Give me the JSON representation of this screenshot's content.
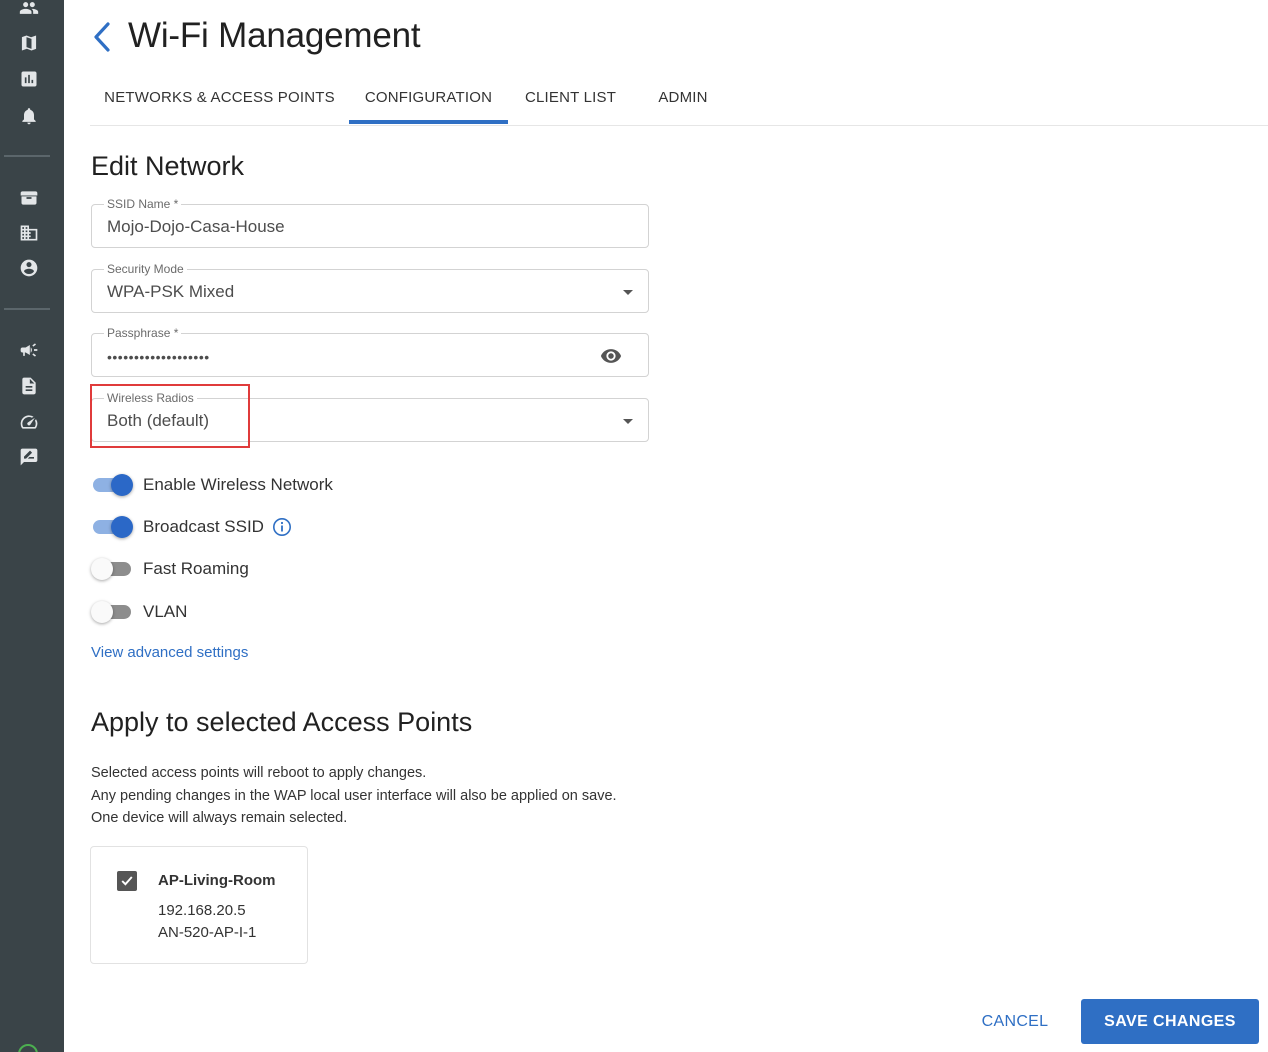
{
  "header": {
    "title": "Wi-Fi Management",
    "back_icon": "chevron-left-icon"
  },
  "tabs": [
    {
      "label": "NETWORKS & ACCESS POINTS",
      "active": false
    },
    {
      "label": "CONFIGURATION",
      "active": true
    },
    {
      "label": "CLIENT LIST",
      "active": false
    },
    {
      "label": "ADMIN",
      "active": false
    }
  ],
  "sidebar": {
    "icons": [
      "people-icon",
      "map-icon",
      "chart-icon",
      "bell-icon",
      "archive-icon",
      "building-icon",
      "account-icon",
      "megaphone-icon",
      "document-icon",
      "speed-icon",
      "feedback-icon"
    ]
  },
  "edit_network": {
    "title": "Edit Network",
    "ssid": {
      "label": "SSID Name *",
      "value": "Mojo-Dojo-Casa-House"
    },
    "security": {
      "label": "Security Mode",
      "value": "WPA-PSK Mixed"
    },
    "passphrase": {
      "label": "Passphrase *",
      "value": "•••••••••••••••••••"
    },
    "radios": {
      "label": "Wireless Radios",
      "value": "Both (default)"
    },
    "toggles": [
      {
        "label": "Enable Wireless Network",
        "on": true
      },
      {
        "label": "Broadcast SSID",
        "on": true
      },
      {
        "label": "Fast Roaming",
        "on": false
      },
      {
        "label": "VLAN",
        "on": false
      }
    ],
    "advanced_link": "View advanced settings"
  },
  "apply": {
    "title": "Apply to selected Access Points",
    "desc1": "Selected access points will reboot to apply changes.",
    "desc2": "Any pending changes in the WAP local user interface will also be applied on save.",
    "desc3": "One device will always remain selected.",
    "ap": {
      "name": "AP-Living-Room",
      "ip": "192.168.20.5",
      "model": "AN-520-AP-I-1",
      "checked": true
    }
  },
  "actions": {
    "cancel": "CANCEL",
    "save": "SAVE CHANGES"
  },
  "colors": {
    "accent": "#2f6fc4",
    "sidebar": "#3a4448",
    "highlight": "#e03b3b"
  }
}
